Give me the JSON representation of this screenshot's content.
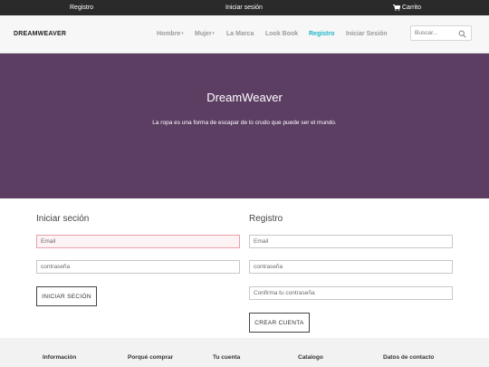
{
  "topbar": {
    "register_label": "Registro",
    "login_label": "Iniciar sesión",
    "cart_label": "Carrito",
    "cart_icon": "shopping-cart-icon"
  },
  "header": {
    "brand": "DREAMWEAVER",
    "nav": {
      "men": "Hombre",
      "women": "Mujer",
      "brand": "La Marca",
      "lookbook": "Look Book",
      "register": "Registro",
      "login": "Iniciar Sesión"
    },
    "search": {
      "placeholder": "Buscar...",
      "icon": "search-icon"
    }
  },
  "hero": {
    "title": "DreamWeaver",
    "subtitle": "La ropa es una forma de escapar de lo crudo que puede ser el mundo."
  },
  "login": {
    "title": "Iniciar seción",
    "email_placeholder": "Email",
    "password_placeholder": "contraseña",
    "submit_label": "INICIAR SECIÓN"
  },
  "register": {
    "title": "Registro",
    "email_placeholder": "Email",
    "password_placeholder": "contraseña",
    "confirm_placeholder": "Confirma tu contraseña",
    "submit_label": "CREAR CUENTA"
  },
  "footer": {
    "columns": [
      "Información",
      "Porqué comprar",
      "Tu cuenta",
      "Catalogo",
      "Datos de contacto"
    ]
  },
  "colors": {
    "topbar": "#2a2a2a",
    "hero": "#5d3e63",
    "accent": "#1fb5c4",
    "invalid_border": "#e8a0a8"
  }
}
